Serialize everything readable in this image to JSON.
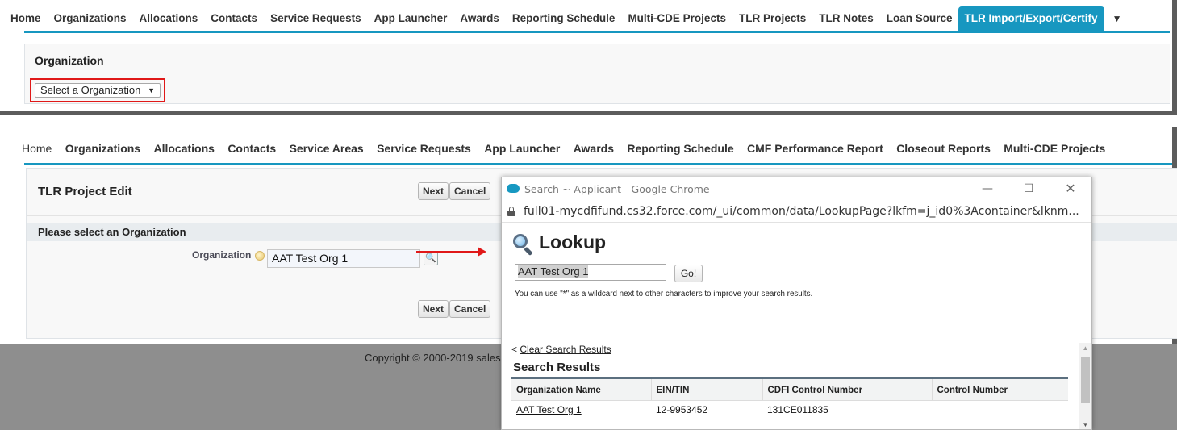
{
  "panel1": {
    "tabs": [
      "Home",
      "Organizations",
      "Allocations",
      "Contacts",
      "Service Requests",
      "App Launcher",
      "Awards",
      "Reporting Schedule",
      "Multi-CDE Projects",
      "TLR Projects",
      "TLR Notes",
      "Loan Source",
      "TLR Import/Export/Certify"
    ],
    "more_arrow": "▼",
    "section_title": "Organization",
    "select_value": "Select a Organization",
    "select_arrow": "▼"
  },
  "panel2": {
    "tabs": [
      "Home",
      "Organizations",
      "Allocations",
      "Contacts",
      "Service Areas",
      "Service Requests",
      "App Launcher",
      "Awards",
      "Reporting Schedule",
      "CMF Performance Report",
      "Closeout Reports",
      "Multi-CDE Projects"
    ],
    "edit_title": "TLR Project Edit",
    "next_label": "Next",
    "cancel_label": "Cancel",
    "section_head": "Please select an Organization",
    "field_label": "Organization",
    "field_value": "AAT Test Org 1",
    "copyright": "Copyright © 2000-2019 sales"
  },
  "popup": {
    "window_title": "Search ~ Applicant - Google Chrome",
    "url": "full01-mycdfifund.cs32.force.com/_ui/common/data/LookupPage?lkfm=j_id0%3Acontainer&lknm...",
    "lookup_title": "Lookup",
    "search_value": "AAT Test Org 1",
    "go_label": "Go!",
    "hint": "You can use \"*\" as a wildcard next to other characters to improve your search results.",
    "clear_prefix": "<",
    "clear_link": "Clear Search Results",
    "results_title": "Search Results",
    "columns": [
      "Organization Name",
      "EIN/TIN",
      "CDFI Control Number",
      "Control Number"
    ],
    "rows": [
      {
        "name": "AAT Test Org 1",
        "ein": "12-9953452",
        "cdfi": "131CE011835",
        "control": ""
      }
    ]
  },
  "colors": {
    "accent_blue": "#1797c0",
    "highlight_red": "#e01818"
  }
}
